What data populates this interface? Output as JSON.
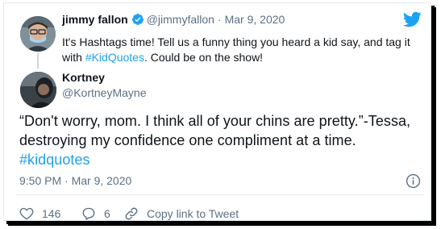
{
  "quoted": {
    "author_name": "jimmy fallon",
    "author_handle": "@jimmyfallon",
    "separator": "·",
    "date": "Mar 9, 2020",
    "text_before": "It's Hashtags time! Tell us a funny thing you heard a kid say, and tag it with ",
    "hashtag": "#KidQuotes",
    "text_after": ". Could be on the show!"
  },
  "reply": {
    "author_name": "Kortney",
    "author_handle": "@KortneyMayne",
    "text": "“Don't worry, mom. I think all of your chins are pretty.”-Tessa, destroying my confidence one compliment at a time.",
    "hashtag": "#kidquotes",
    "timestamp": "9:50 PM · Mar 9, 2020"
  },
  "actions": {
    "likes": "146",
    "replies": "6",
    "copy_link_label": "Copy link to Tweet"
  },
  "icons": {
    "brand": "twitter-bird-icon",
    "verified": "verified-badge-icon",
    "info": "info-icon",
    "like": "heart-icon",
    "reply": "reply-bubble-icon",
    "link": "link-icon"
  },
  "colors": {
    "twitter_blue": "#1da1f2",
    "secondary_text": "#5b7083",
    "primary_text": "#0f1419",
    "border": "#e1e8ed"
  }
}
